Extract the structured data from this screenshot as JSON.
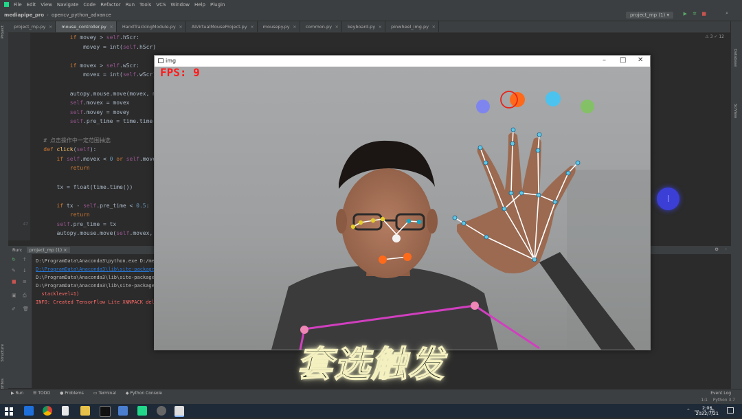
{
  "ide": {
    "menu": [
      "File",
      "Edit",
      "View",
      "Navigate",
      "Code",
      "Refactor",
      "Run",
      "Tools",
      "VCS",
      "Window",
      "Help",
      "Plugin"
    ],
    "project": "mediapipe_pro",
    "breadcrumb": "opencv_python_advance",
    "run_config": "project_mp (1)",
    "tabs": [
      "project_mp.py",
      "mouse_controller.py",
      "HandTrackingModule.py",
      "AIVirtualMouseProject.py",
      "mousepy.py",
      "common.py",
      "keyboard.py",
      "pinwheel_img.py"
    ],
    "active_tab": 1,
    "inspection": "⚠ 3 ✓ 12"
  },
  "code": {
    "line_numbers": [
      "",
      "",
      "",
      "",
      "",
      "",
      "",
      "",
      "",
      "",
      "",
      "",
      "",
      "",
      "",
      "",
      "",
      "",
      "",
      "",
      "47",
      ""
    ],
    "lines": [
      [
        {
          "t": "            ",
          "c": "pl"
        },
        {
          "t": "if ",
          "c": "kw"
        },
        {
          "t": "movey > ",
          "c": "pl"
        },
        {
          "t": "self",
          "c": "sf"
        },
        {
          "t": ".hScr:",
          "c": "pl"
        }
      ],
      [
        {
          "t": "                movey = int(",
          "c": "pl"
        },
        {
          "t": "self",
          "c": "sf"
        },
        {
          "t": ".hScr)",
          "c": "pl"
        }
      ],
      [
        {
          "t": "",
          "c": "pl"
        }
      ],
      [
        {
          "t": "            ",
          "c": "pl"
        },
        {
          "t": "if ",
          "c": "kw"
        },
        {
          "t": "movex > ",
          "c": "pl"
        },
        {
          "t": "self",
          "c": "sf"
        },
        {
          "t": ".wScr:",
          "c": "pl"
        }
      ],
      [
        {
          "t": "                movex = int(",
          "c": "pl"
        },
        {
          "t": "self",
          "c": "sf"
        },
        {
          "t": ".wScr)",
          "c": "pl"
        }
      ],
      [
        {
          "t": "",
          "c": "pl"
        }
      ],
      [
        {
          "t": "            autopy.mouse.move(movex, movey)",
          "c": "pl"
        }
      ],
      [
        {
          "t": "            ",
          "c": "pl"
        },
        {
          "t": "self",
          "c": "sf"
        },
        {
          "t": ".movex = movex",
          "c": "pl"
        }
      ],
      [
        {
          "t": "            ",
          "c": "pl"
        },
        {
          "t": "self",
          "c": "sf"
        },
        {
          "t": ".movey = movey",
          "c": "pl"
        }
      ],
      [
        {
          "t": "            ",
          "c": "pl"
        },
        {
          "t": "self",
          "c": "sf"
        },
        {
          "t": ".pre_time = time.time()",
          "c": "pl"
        }
      ],
      [
        {
          "t": "",
          "c": "pl"
        }
      ],
      [
        {
          "t": "    # 点击操作中一定范围抽选",
          "c": "cm"
        }
      ],
      [
        {
          "t": "    ",
          "c": "pl"
        },
        {
          "t": "def ",
          "c": "kw"
        },
        {
          "t": "click",
          "c": "fn"
        },
        {
          "t": "(",
          "c": "pl"
        },
        {
          "t": "self",
          "c": "sf"
        },
        {
          "t": "):",
          "c": "pl"
        }
      ],
      [
        {
          "t": "        ",
          "c": "pl"
        },
        {
          "t": "if ",
          "c": "kw"
        },
        {
          "t": "self",
          "c": "sf"
        },
        {
          "t": ".movex < ",
          "c": "pl"
        },
        {
          "t": "0",
          "c": "nm"
        },
        {
          "t": " or ",
          "c": "kw"
        },
        {
          "t": "self",
          "c": "sf"
        },
        {
          "t": ".movey < ",
          "c": "pl"
        },
        {
          "t": "0",
          "c": "nm"
        },
        {
          "t": ":",
          "c": "pl"
        }
      ],
      [
        {
          "t": "            ",
          "c": "pl"
        },
        {
          "t": "return",
          "c": "kw"
        }
      ],
      [
        {
          "t": "",
          "c": "pl"
        }
      ],
      [
        {
          "t": "        tx = float(time.time())",
          "c": "pl"
        }
      ],
      [
        {
          "t": "",
          "c": "pl"
        }
      ],
      [
        {
          "t": "        ",
          "c": "pl"
        },
        {
          "t": "if ",
          "c": "kw"
        },
        {
          "t": "tx - ",
          "c": "pl"
        },
        {
          "t": "self",
          "c": "sf"
        },
        {
          "t": ".pre_time < ",
          "c": "pl"
        },
        {
          "t": "0.5",
          "c": "nm"
        },
        {
          "t": ":",
          "c": "pl"
        }
      ],
      [
        {
          "t": "            ",
          "c": "pl"
        },
        {
          "t": "return",
          "c": "kw"
        }
      ],
      [
        {
          "t": "        ",
          "c": "pl"
        },
        {
          "t": "self",
          "c": "sf"
        },
        {
          "t": ".pre_time = tx",
          "c": "pl"
        }
      ],
      [
        {
          "t": "        autopy.mouse.move(",
          "c": "pl"
        },
        {
          "t": "self",
          "c": "sf"
        },
        {
          "t": ".movex, ",
          "c": "pl"
        },
        {
          "t": "self",
          "c": "sf"
        },
        {
          "t": ".movey)",
          "c": "pl"
        }
      ]
    ]
  },
  "run": {
    "label": "Run:",
    "config": "project_mp (1)",
    "console": [
      {
        "text": "D:\\ProgramData\\Anaconda3\\python.exe D:/mediapipe_pro/project_mp.py",
        "style": "c-path"
      },
      {
        "text": "D:\\ProgramData\\Anaconda3\\lib\\site-packages\\google\\protobuf\\internal",
        "style": "c-link"
      },
      {
        "text": "D:\\ProgramData\\Anaconda3\\lib\\site-packages\\google\\protobuf\\",
        "style": "c-path"
      },
      {
        "text": "D:\\ProgramData\\Anaconda3\\lib\\site-packages\\google\\protobuf\\",
        "style": "c-path"
      },
      {
        "text": "  stacklevel=1)",
        "style": "c-err"
      },
      {
        "text": "INFO: Created TensorFlow Lite XNNPACK delegate for CPU.",
        "style": "c-err"
      }
    ]
  },
  "bottom_tools": [
    "Run",
    "TODO",
    "Problems",
    "Terminal",
    "Python Console"
  ],
  "event_log": "Event Log",
  "status_right": "Python 3.7",
  "status_pos": "1:1",
  "window": {
    "title": "img",
    "fps_label": "FPS: 9"
  },
  "subtitle": "套选触发",
  "clock": {
    "time": "2:06",
    "date": "2022/7/21"
  },
  "tray_text": "中"
}
